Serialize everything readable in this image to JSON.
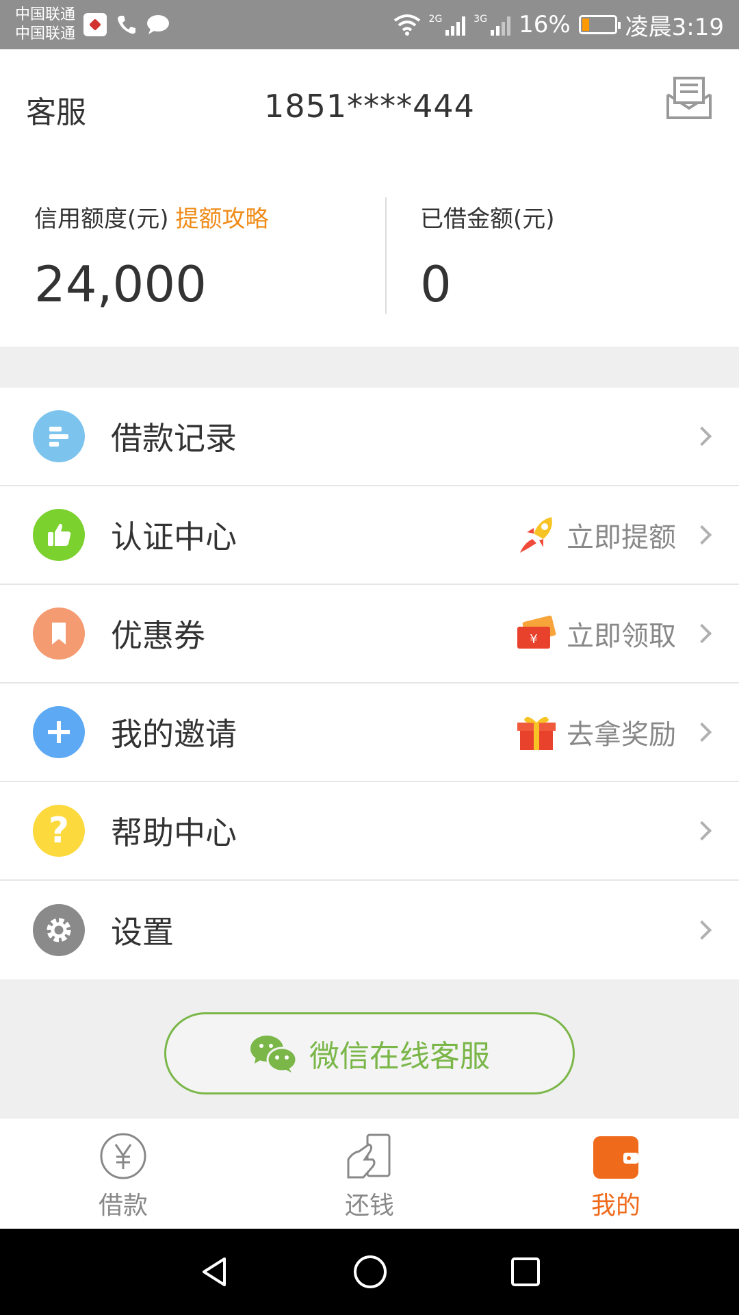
{
  "status_bar": {
    "carrier1": "中国联通",
    "carrier2": "中国联通",
    "net1": "2G",
    "net2": "3G",
    "battery": "16%",
    "time": "凌晨3:19"
  },
  "header": {
    "service_label": "客服",
    "phone": "1851****444",
    "message_icon": "envelope-icon"
  },
  "credit": {
    "limit_label": "信用额度(元)",
    "limit_link": "提额攻略",
    "limit_value": "24,000",
    "borrowed_label": "已借金额(元)",
    "borrowed_value": "0"
  },
  "menu": [
    {
      "label": "借款记录",
      "icon": "list-icon",
      "color": "#7cc4ee",
      "hint": ""
    },
    {
      "label": "认证中心",
      "icon": "thumbs-up-icon",
      "color": "#7bd12e",
      "hint": "立即提额",
      "hint_icon": "rocket-icon"
    },
    {
      "label": "优惠券",
      "icon": "bookmark-icon",
      "color": "#f59b72",
      "hint": "立即领取",
      "hint_icon": "coupon-icon"
    },
    {
      "label": "我的邀请",
      "icon": "plus-icon",
      "color": "#5ea9f3",
      "hint": "去拿奖励",
      "hint_icon": "gift-icon"
    },
    {
      "label": "帮助中心",
      "icon": "question-icon",
      "color": "#fcd93d",
      "hint": ""
    },
    {
      "label": "设置",
      "icon": "gear-icon",
      "color": "#8a8a8a",
      "hint": ""
    }
  ],
  "wechat_button": "微信在线客服",
  "tabs": [
    {
      "label": "借款",
      "icon": "yuan-icon"
    },
    {
      "label": "还钱",
      "icon": "repay-icon"
    },
    {
      "label": "我的",
      "icon": "wallet-icon"
    }
  ],
  "colors": {
    "accent": "#f06a1b",
    "link": "#f08c1a",
    "wechat": "#7ab648"
  }
}
